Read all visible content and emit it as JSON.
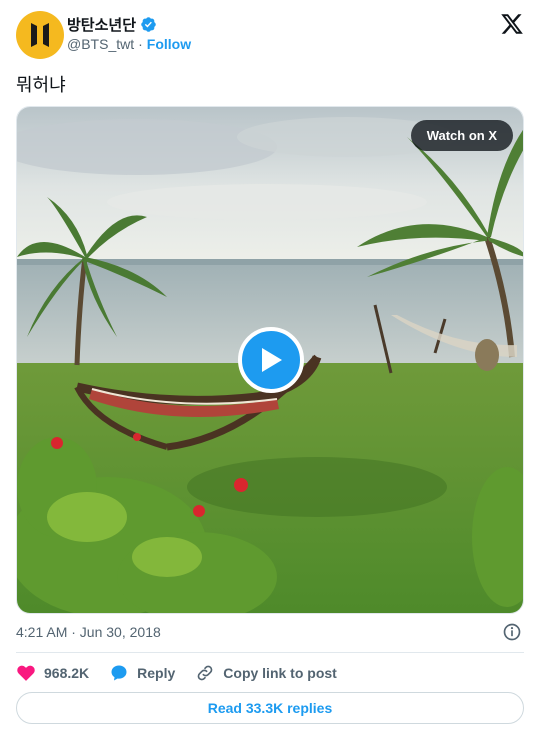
{
  "author": {
    "display_name": "방탄소년단",
    "handle": "@BTS_twt",
    "separator": "·",
    "follow_label": "Follow",
    "avatar_color": "#f5b91f",
    "verified_color": "#1d9bf0"
  },
  "tweet": {
    "text": "뭐허냐",
    "timestamp": "4:21 AM · Jun 30, 2018"
  },
  "media": {
    "watch_label": "Watch on X",
    "play_icon": "play-icon"
  },
  "actions": {
    "likes": "968.2K",
    "reply_label": "Reply",
    "copy_label": "Copy link to post"
  },
  "read_replies_label": "Read 33.3K replies",
  "colors": {
    "accent": "#1d9bf0",
    "like": "#f91880",
    "muted": "#536471"
  }
}
